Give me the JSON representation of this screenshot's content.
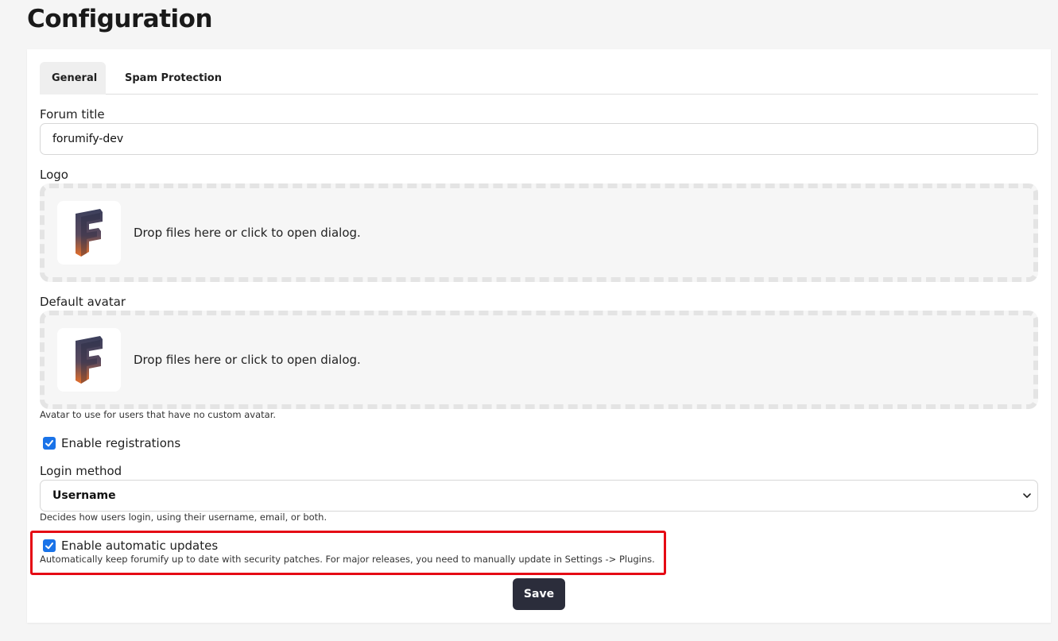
{
  "page": {
    "title": "Configuration"
  },
  "tabs": [
    {
      "label": "General",
      "active": true
    },
    {
      "label": "Spam Protection",
      "active": false
    }
  ],
  "forum_title": {
    "label": "Forum title",
    "value": "forumify-dev"
  },
  "logo": {
    "label": "Logo",
    "dropzone_text": "Drop files here or click to open dialog.",
    "thumbnail_icon": "forumify-logo-icon"
  },
  "default_avatar": {
    "label": "Default avatar",
    "dropzone_text": "Drop files here or click to open dialog.",
    "hint": "Avatar to use for users that have no custom avatar.",
    "thumbnail_icon": "forumify-logo-icon"
  },
  "registrations": {
    "label": "Enable registrations",
    "checked": true
  },
  "login_method": {
    "label": "Login method",
    "selected": "Username",
    "hint": "Decides how users login, using their username, email, or both."
  },
  "auto_updates": {
    "label": "Enable automatic updates",
    "checked": true,
    "hint": "Automatically keep forumify up to date with security patches. For major releases, you need to manually update in Settings -> Plugins."
  },
  "save_label": "Save",
  "colors": {
    "accent": "#1a73e8",
    "button": "#2b2d3b",
    "highlight": "#e50914"
  }
}
